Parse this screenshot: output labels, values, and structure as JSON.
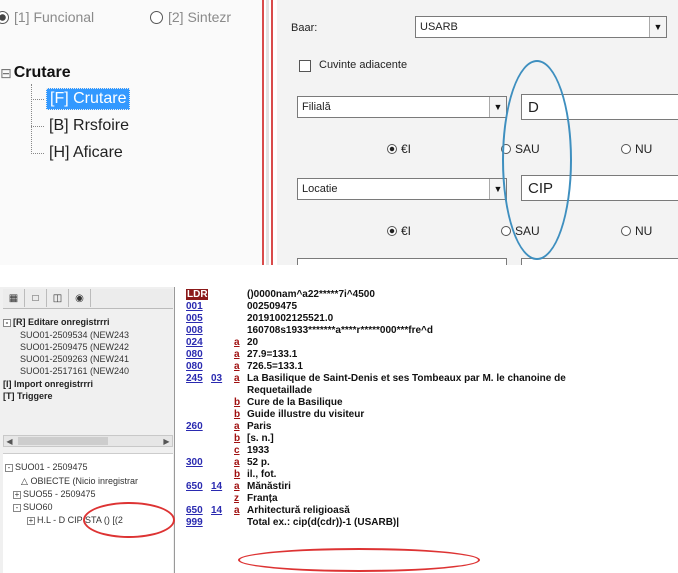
{
  "top": {
    "modes": [
      {
        "label": "[1] Funcional",
        "selected": true
      },
      {
        "label": "[2] Sintezr",
        "selected": false
      }
    ],
    "tree": {
      "root": "Crutare",
      "children": [
        {
          "label": "[F] Crutare",
          "selected": true
        },
        {
          "label": "[B] Rrsfoire",
          "selected": false
        },
        {
          "label": "[H] Aficare",
          "selected": false
        }
      ]
    },
    "form": {
      "base_label": "Baar:",
      "base_value": "USARB",
      "adjacent_label": "Cuvinte adiacente",
      "field1": {
        "combo": "Filială",
        "value": "D"
      },
      "field2": {
        "combo": "Locatie",
        "value": "CIP"
      },
      "options": [
        "€I",
        "SAU",
        "NU"
      ],
      "selected_option": "€I"
    },
    "colors": {
      "highlight": "#3399ff",
      "annotation_blue": "#3e8fbf",
      "divider": "#d94b4b"
    }
  },
  "bottom": {
    "toolbar_icons": [
      "record-icon",
      "document-icon",
      "copy-icon",
      "binoculars-icon"
    ],
    "tree_upper": {
      "root": "[R] Editare onregistrrri",
      "records": [
        "SUO01-2509534 (NEW243",
        "SUO01-2509475 (NEW242",
        "SUO01-2509263 (NEW241",
        "SUO01-2517161 (NEW240"
      ],
      "import": "[I] Import onregistrrri",
      "triggers": "[T] Triggere"
    },
    "tree_lower": {
      "root": "SUO01 - 2509475",
      "objects": "OBIECTE (Nicio inregistrar",
      "suo55": "SUO55 - 2509475",
      "suo60": "SUO60",
      "holding": "H.L - D CIP STA () [(2"
    },
    "marc": [
      {
        "tag": "LDR",
        "ind": "",
        "sub": "",
        "value": "()0000nam^a22*****7i^4500"
      },
      {
        "tag": "001",
        "ind": "",
        "sub": "",
        "value": "002509475"
      },
      {
        "tag": "005",
        "ind": "",
        "sub": "",
        "value": "20191002125521.0"
      },
      {
        "tag": "008",
        "ind": "",
        "sub": "",
        "value": "160708s1933*******a****r*****000***fre^d"
      },
      {
        "tag": "024",
        "ind": "",
        "sub": "a",
        "value": "20"
      },
      {
        "tag": "080",
        "ind": "",
        "sub": "a",
        "value": "27.9=133.1"
      },
      {
        "tag": "080",
        "ind": "",
        "sub": "a",
        "value": "726.5=133.1"
      },
      {
        "tag": "245",
        "ind": "03",
        "sub": "a",
        "value": "La Basilique de Saint-Denis et ses Tombeaux par M. le chanoine de"
      },
      {
        "tag": "",
        "ind": "",
        "sub": "",
        "value": "Requetaillade"
      },
      {
        "tag": "",
        "ind": "",
        "sub": "b",
        "value": "Cure de la Basilique"
      },
      {
        "tag": "",
        "ind": "",
        "sub": "b",
        "value": "Guide illustre du visiteur"
      },
      {
        "tag": "260",
        "ind": "",
        "sub": "a",
        "value": "Paris"
      },
      {
        "tag": "",
        "ind": "",
        "sub": "b",
        "value": "[s. n.]"
      },
      {
        "tag": "",
        "ind": "",
        "sub": "c",
        "value": "1933"
      },
      {
        "tag": "300",
        "ind": "",
        "sub": "a",
        "value": "52 p."
      },
      {
        "tag": "",
        "ind": "",
        "sub": "b",
        "value": "il., fot."
      },
      {
        "tag": "650",
        "ind": "14",
        "sub": "a",
        "value": "Mănăstiri"
      },
      {
        "tag": "",
        "ind": "",
        "sub": "z",
        "value": "Franța"
      },
      {
        "tag": "650",
        "ind": "14",
        "sub": "a",
        "value": "Arhitectură religioasă"
      },
      {
        "tag": "999",
        "ind": "",
        "sub": "",
        "value": "Total ex.: cip(d(cdr))-1 (USARB)|"
      }
    ],
    "colors": {
      "ldr_bg": "#8b1a1a",
      "tag": "#2a2ab0",
      "subfield": "#a01010",
      "annotation_red": "#dd3333"
    }
  }
}
